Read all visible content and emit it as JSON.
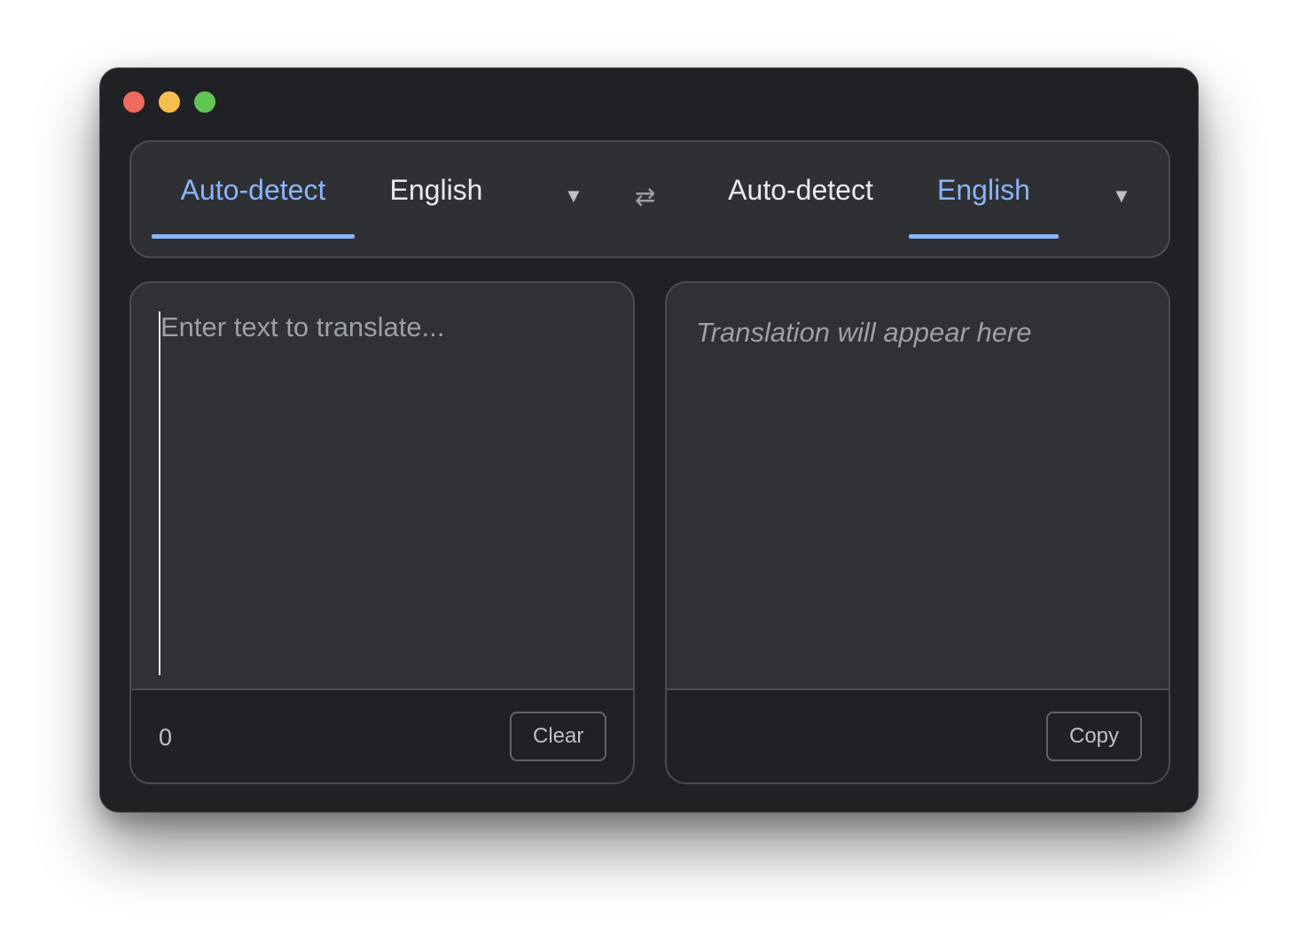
{
  "window": {
    "controls": [
      "close",
      "minimize",
      "maximize"
    ]
  },
  "source": {
    "tabs": [
      {
        "label": "Auto-detect",
        "active": true
      },
      {
        "label": "English",
        "active": false
      }
    ],
    "dropdown_icon": "▼",
    "placeholder": "Enter text to translate...",
    "char_count": "0",
    "clear_label": "Clear"
  },
  "swap_icon": "⇄",
  "target": {
    "tabs": [
      {
        "label": "Auto-detect",
        "active": false
      },
      {
        "label": "English",
        "active": true
      }
    ],
    "dropdown_icon": "▼",
    "output_placeholder": "Translation will appear here",
    "copy_label": "Copy"
  },
  "colors": {
    "accent": "#8ab4f8",
    "background": "#202124",
    "panel": "#303134"
  }
}
